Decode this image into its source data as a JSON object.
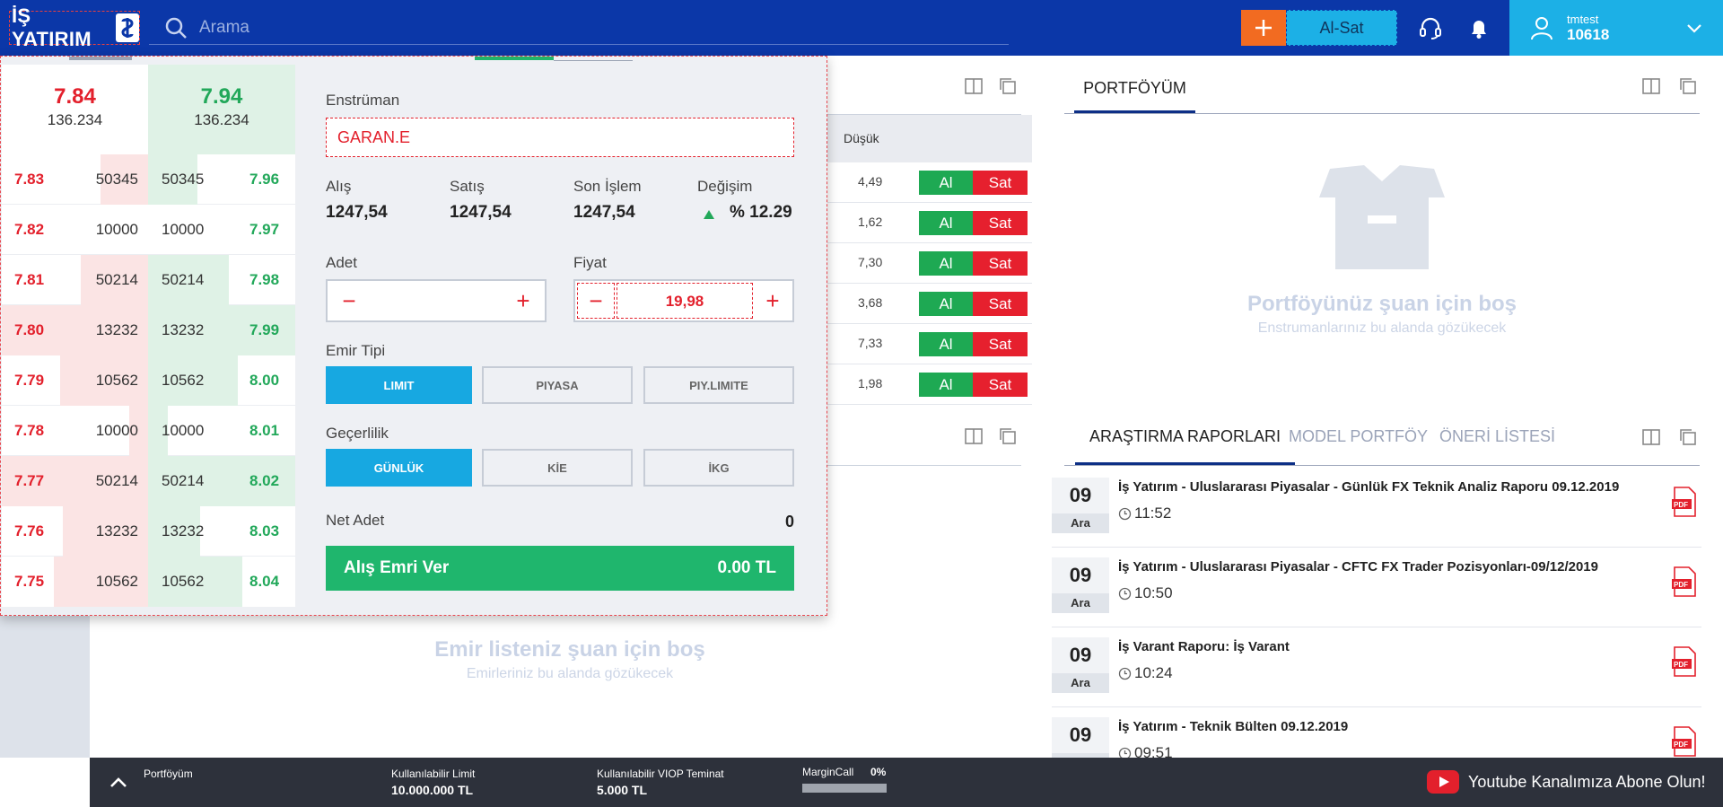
{
  "header": {
    "logo_text": "İŞ YATIRIM",
    "search_placeholder": "Arama",
    "alsat_label": "Al-Sat",
    "user_name": "tmtest",
    "user_id": "10618"
  },
  "market_table": {
    "col_low": "Düşük",
    "rows": [
      {
        "low": "4,49",
        "buy": "Al",
        "sell": "Sat"
      },
      {
        "low": "1,62",
        "buy": "Al",
        "sell": "Sat"
      },
      {
        "low": "7,30",
        "buy": "Al",
        "sell": "Sat"
      },
      {
        "low": "3,68",
        "buy": "Al",
        "sell": "Sat"
      },
      {
        "low": "7,33",
        "buy": "Al",
        "sell": "Sat"
      },
      {
        "low": "1,98",
        "buy": "Al",
        "sell": "Sat"
      }
    ]
  },
  "orders_empty": {
    "title": "Emir listeniz şuan için boş",
    "subtitle": "Emirleriniz bu alanda gözükecek"
  },
  "portfolio": {
    "tab": "PORTFÖYÜM",
    "empty_title": "Portföyünüz şuan için boş",
    "empty_subtitle": "Enstrumanlarınız bu alanda gözükecek"
  },
  "research": {
    "tabs": [
      "ARAŞTIRMA RAPORLARI",
      "MODEL PORTFÖY",
      "ÖNERİ LİSTESİ"
    ],
    "reports": [
      {
        "day": "09",
        "month": "Ara",
        "title": "İş Yatırım - Uluslararası Piyasalar - Günlük FX Teknik Analiz Raporu 09.12.2019",
        "time": "11:52"
      },
      {
        "day": "09",
        "month": "Ara",
        "title": "İş Yatırım - Uluslararası Piyasalar - CFTC FX Trader Pozisyonları-09/12/2019",
        "time": "10:50"
      },
      {
        "day": "09",
        "month": "Ara",
        "title": "İş Varant Raporu: İş Varant",
        "time": "10:24"
      },
      {
        "day": "09",
        "month": "Ara",
        "title": "İş Yatırım - Teknik Bülten 09.12.2019",
        "time": "09:51"
      }
    ]
  },
  "bottom": {
    "portfolio": "Portföyüm",
    "limit_label": "Kullanılabilir Limit",
    "limit_value": "10.000.000 TL",
    "viop_label": "Kullanılabilir VIOP Teminat",
    "viop_value": "5.000 TL",
    "margin_label": "MarginCall",
    "margin_value": "0%",
    "margin_fill": 0,
    "youtube": "Youtube Kanalımıza Abone Olun!"
  },
  "depth": {
    "bid_price": "7.84",
    "bid_qty": "136.234",
    "ask_price": "7.94",
    "ask_qty": "136.234",
    "rows": [
      {
        "bp": "7.83",
        "bq": "50345",
        "aq": "50345",
        "ap": "7.96"
      },
      {
        "bp": "7.82",
        "bq": "10000",
        "aq": "10000",
        "ap": "7.97"
      },
      {
        "bp": "7.81",
        "bq": "50214",
        "aq": "50214",
        "ap": "7.98"
      },
      {
        "bp": "7.80",
        "bq": "13232",
        "aq": "13232",
        "ap": "7.99"
      },
      {
        "bp": "7.79",
        "bq": "10562",
        "aq": "10562",
        "ap": "8.00"
      },
      {
        "bp": "7.78",
        "bq": "10000",
        "aq": "10000",
        "ap": "8.01"
      },
      {
        "bp": "7.77",
        "bq": "50214",
        "aq": "50214",
        "ap": "8.02"
      },
      {
        "bp": "7.76",
        "bq": "13232",
        "aq": "13232",
        "ap": "8.03"
      },
      {
        "bp": "7.75",
        "bq": "10562",
        "aq": "10562",
        "ap": "8.04"
      }
    ]
  },
  "order": {
    "instrument_label": "Enstrüman",
    "instrument": "GARAN.E",
    "buy_label": "Alış",
    "buy_value": "1247,54",
    "sell_label": "Satış",
    "sell_value": "1247,54",
    "last_label": "Son İşlem",
    "last_value": "1247,54",
    "change_label": "Değişim",
    "change_value": "% 12.29",
    "qty_label": "Adet",
    "qty_value": "",
    "price_label": "Fiyat",
    "price_value": "19,98",
    "type_label": "Emir Tipi",
    "types": [
      "LIMIT",
      "PIYASA",
      "PIY.LIMITE"
    ],
    "validity_label": "Geçerlilik",
    "validities": [
      "GÜNLÜK",
      "KİE",
      "İKG"
    ],
    "net_label": "Net Adet",
    "net_value": "0",
    "submit_label": "Alış Emri Ver",
    "submit_amount": "0.00 TL"
  },
  "colors": {
    "header_bg": "#0b37a8",
    "accent_orange": "#f26b21",
    "accent_cyan": "#1cb0e6",
    "buy_green": "#1ea953",
    "sell_red": "#e6202e"
  }
}
